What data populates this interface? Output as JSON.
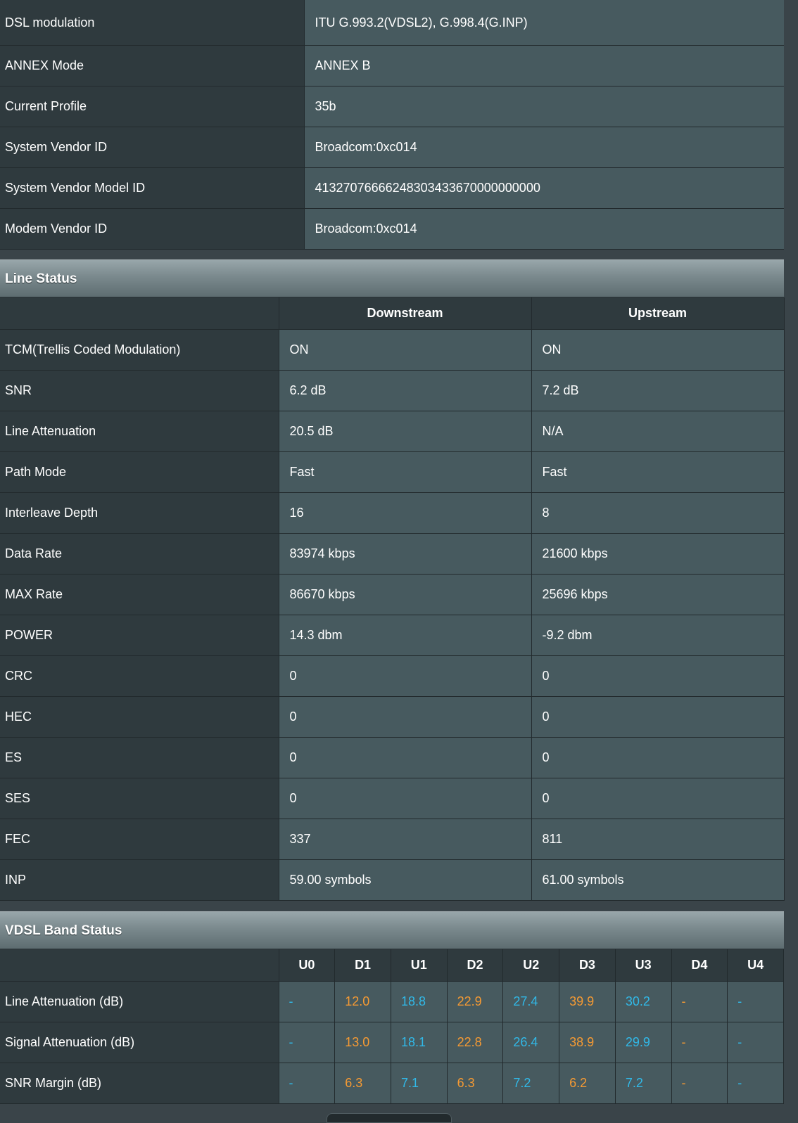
{
  "info_rows": [
    {
      "label": "DSL modulation",
      "value": "ITU G.993.2(VDSL2), G.998.4(G.INP)"
    },
    {
      "label": "ANNEX Mode",
      "value": "ANNEX B"
    },
    {
      "label": "Current Profile",
      "value": "35b"
    },
    {
      "label": "System Vendor ID",
      "value": "Broadcom:0xc014"
    },
    {
      "label": "System Vendor Model ID",
      "value": "41327076666248303433670000000000"
    },
    {
      "label": "Modem Vendor ID",
      "value": "Broadcom:0xc014"
    }
  ],
  "line_status": {
    "title": "Line Status",
    "headers": {
      "downstream": "Downstream",
      "upstream": "Upstream"
    },
    "rows": [
      {
        "label": "TCM(Trellis Coded Modulation)",
        "down": "ON",
        "up": "ON"
      },
      {
        "label": "SNR",
        "down": "6.2 dB",
        "up": "7.2 dB"
      },
      {
        "label": "Line Attenuation",
        "down": "20.5 dB",
        "up": "N/A"
      },
      {
        "label": "Path Mode",
        "down": "Fast",
        "up": "Fast"
      },
      {
        "label": "Interleave Depth",
        "down": "16",
        "up": "8"
      },
      {
        "label": "Data Rate",
        "down": "83974 kbps",
        "up": "21600 kbps"
      },
      {
        "label": "MAX Rate",
        "down": "86670 kbps",
        "up": "25696 kbps"
      },
      {
        "label": "POWER",
        "down": "14.3 dbm",
        "up": "-9.2 dbm"
      },
      {
        "label": "CRC",
        "down": "0",
        "up": "0"
      },
      {
        "label": "HEC",
        "down": "0",
        "up": "0"
      },
      {
        "label": "ES",
        "down": "0",
        "up": "0"
      },
      {
        "label": "SES",
        "down": "0",
        "up": "0"
      },
      {
        "label": "FEC",
        "down": "337",
        "up": "811"
      },
      {
        "label": "INP",
        "down": "59.00 symbols",
        "up": "61.00 symbols"
      }
    ]
  },
  "vdsl_band_status": {
    "title": "VDSL Band Status",
    "bands": [
      "U0",
      "D1",
      "U1",
      "D2",
      "U2",
      "D3",
      "U3",
      "D4",
      "U4"
    ],
    "rows": [
      {
        "label": "Line Attenuation (dB)",
        "values": [
          "-",
          "12.0",
          "18.8",
          "22.9",
          "27.4",
          "39.9",
          "30.2",
          "-",
          "-"
        ]
      },
      {
        "label": "Signal Attenuation (dB)",
        "values": [
          "-",
          "13.0",
          "18.1",
          "22.8",
          "26.4",
          "38.9",
          "29.9",
          "-",
          "-"
        ]
      },
      {
        "label": "SNR Margin (dB)",
        "values": [
          "-",
          "6.3",
          "7.1",
          "6.3",
          "7.2",
          "6.2",
          "7.2",
          "-",
          "-"
        ]
      }
    ]
  },
  "colors": {
    "downstream_band": "#f59a33",
    "upstream_band": "#31b9e8"
  }
}
